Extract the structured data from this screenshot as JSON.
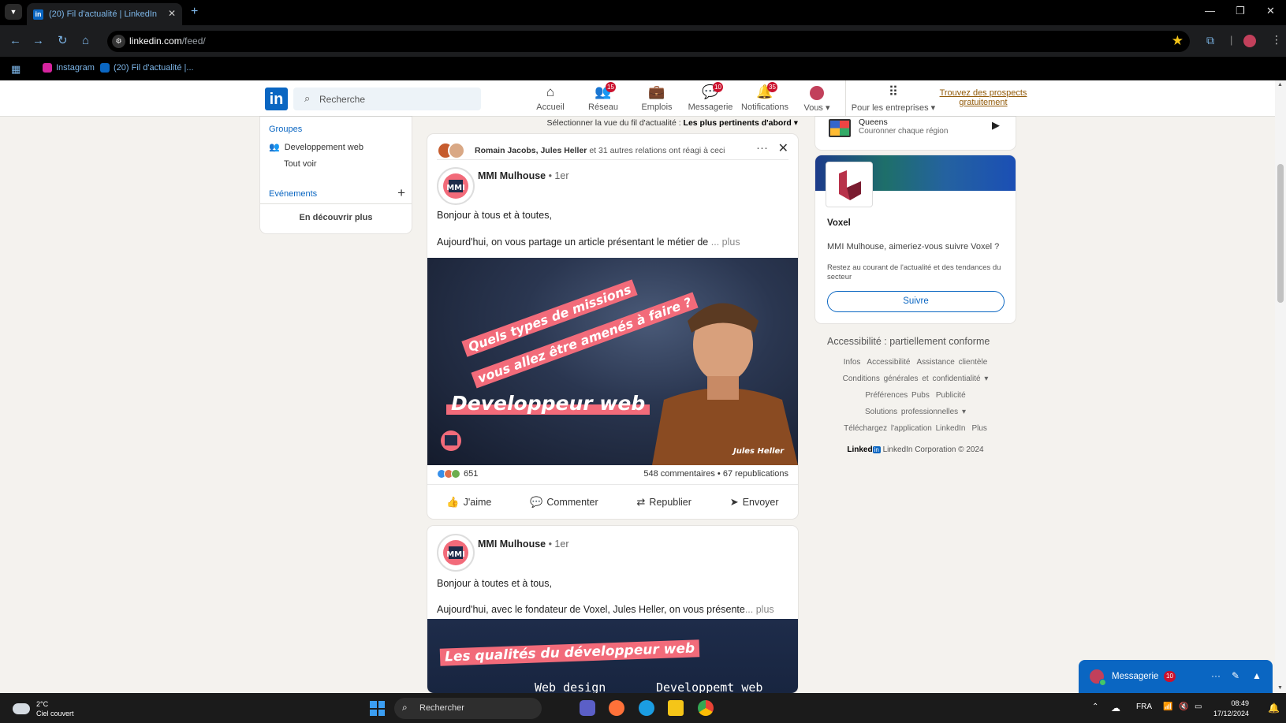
{
  "browser": {
    "tab_title": "(20) Fil d'actualité | LinkedIn",
    "url_host": "linkedin.com",
    "url_path": "/feed/",
    "bookmarks": [
      {
        "label": "Instagram",
        "color": "#d6249f"
      },
      {
        "label": "(20) Fil d'actualité |...",
        "color": "#0a66c2"
      }
    ]
  },
  "header": {
    "logo": "in",
    "search_placeholder": "Recherche",
    "nav": [
      {
        "label": "Accueil",
        "icon": "home-icon",
        "badge": ""
      },
      {
        "label": "Réseau",
        "icon": "network-icon",
        "badge": "15"
      },
      {
        "label": "Emplois",
        "icon": "briefcase-icon",
        "badge": ""
      },
      {
        "label": "Messagerie",
        "icon": "message-icon",
        "badge": "10"
      },
      {
        "label": "Notifications",
        "icon": "bell-icon",
        "badge": "35"
      },
      {
        "label": "Vous ▾",
        "icon": "avatar-icon",
        "badge": ""
      }
    ],
    "business": "Pour les entreprises ▾",
    "prospects": "Trouvez des prospects gratuitement"
  },
  "left": {
    "groups_title": "Groupes",
    "group_item": "Developpement web",
    "see_all": "Tout voir",
    "events_title": "Evénements",
    "discover": "En découvrir plus"
  },
  "feed": {
    "sort_prefix": "Sélectionner la vue du fil d'actualité : ",
    "sort_value": "Les plus pertinents d'abord ▾",
    "post1": {
      "ctx_names": "Romain Jacobs, Jules Heller",
      "ctx_rest": " et 31 autres relations ont réagi à ceci",
      "author": "MMI Mulhouse",
      "degree": " • 1er",
      "line1": "Bonjour à tous et à toutes,",
      "line2": "Aujourd'hui, on vous partage un article présentant le métier de ",
      "more": "... plus",
      "banner1": "Quels types de missions",
      "banner2": "vous allez être amenés à faire ?",
      "banner3": "Developpeur web",
      "caption": "Jules Heller",
      "reactions": "651",
      "stats_right": "548 commentaires • 67 republications"
    },
    "actions": [
      "J'aime",
      "Commenter",
      "Republier",
      "Envoyer"
    ],
    "post2": {
      "author": "MMI Mulhouse",
      "degree": " • 1er",
      "line1": "Bonjour à toutes et à tous,",
      "line2": "Aujourd'hui, avec le fondateur de Voxel, Jules Heller, on vous présente",
      "more": "... plus",
      "banner": "Les qualités du développeur web",
      "sub_left": "Web design",
      "sub_right": "Developpemt web"
    }
  },
  "right": {
    "queens_title": "Queens",
    "queens_sub": "Couronner chaque région",
    "voxel_name": "Voxel",
    "voxel_question": "MMI Mulhouse, aimeriez-vous suivre Voxel ?",
    "voxel_desc": "Restez au courant de l'actualité et des tendances du secteur",
    "follow": "Suivre",
    "accessibility": "Accessibilité : partiellement conforme",
    "footer_row1": [
      "Infos",
      "Accessibilité",
      "Assistance clientèle"
    ],
    "footer_row2": "Conditions générales et confidentialité ▾",
    "footer_row3": [
      "Préférences Pubs",
      "Publicité"
    ],
    "footer_row4": "Solutions professionnelles ▾",
    "footer_row5": [
      "Téléchargez l'application LinkedIn",
      "Plus"
    ],
    "copyright": "LinkedIn Corporation © 2024",
    "mini_logo": "Linked"
  },
  "messaging": {
    "title": "Messagerie",
    "badge": "10"
  },
  "taskbar": {
    "temp": "2°C",
    "weather": "Ciel couvert",
    "search": "Rechercher",
    "lang": "FRA",
    "time": "08:49",
    "date": "17/12/2024"
  },
  "colors": {
    "linkedin_blue": "#0a66c2",
    "badge_red": "#cb112d",
    "banner_pink": "#f26b7a"
  }
}
